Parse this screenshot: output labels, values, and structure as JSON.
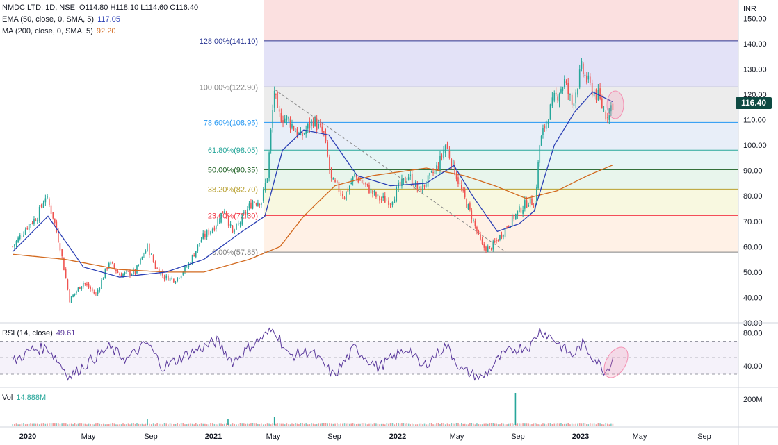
{
  "header": {
    "symbol": "NMDC LTD, 1D, NSE",
    "open_label": "O",
    "open": "114.80",
    "high_label": "H",
    "high": "118.10",
    "low_label": "L",
    "low": "114.60",
    "close_label": "C",
    "close": "116.40"
  },
  "indicators": {
    "ema": {
      "label": "EMA (50, close, 0, SMA, 5)",
      "value": "117.05",
      "color": "#2a3fb4"
    },
    "ma": {
      "label": "MA (200, close, 0, SMA, 5)",
      "value": "92.20",
      "color": "#d2691e"
    },
    "rsi": {
      "label": "RSI (14, close)",
      "value": "49.61",
      "color": "#5b3a9c"
    },
    "vol": {
      "label": "Vol",
      "value": "14.888M",
      "color": "#26a69a"
    }
  },
  "last_price": {
    "value": "116.40",
    "color": "#0e4a42"
  },
  "colors": {
    "up": "#26a69a",
    "down": "#ef5350"
  },
  "chart_data": {
    "type": "candlestick",
    "currency_label": "INR",
    "price_axis": {
      "ticks": [
        "150.00",
        "140.00",
        "130.00",
        "120.00",
        "110.00",
        "100.00",
        "90.00",
        "80.00",
        "70.00",
        "60.00",
        "50.00",
        "40.00",
        "30.00"
      ],
      "range": [
        30,
        155
      ]
    },
    "rsi_axis": {
      "ticks": [
        "80.00",
        "40.00"
      ],
      "bands": [
        30,
        50,
        70
      ]
    },
    "volume_axis": {
      "ticks": [
        "200M"
      ],
      "max": 280
    },
    "time_axis": [
      "2020",
      "May",
      "Sep",
      "2021",
      "May",
      "Sep",
      "2022",
      "May",
      "Sep",
      "2023",
      "May",
      "Sep"
    ],
    "fib_levels": [
      {
        "label": "0.00%(57.85)",
        "value": 57.85,
        "color": "#808080"
      },
      {
        "label": "23.60%(72.30)",
        "value": 72.3,
        "color": "#f23645"
      },
      {
        "label": "38.20%(82.70)",
        "value": 82.7,
        "color": "#b8a030"
      },
      {
        "label": "50.00%(90.35)",
        "value": 90.35,
        "color": "#1b5e20"
      },
      {
        "label": "61.80%(98.05)",
        "value": 98.05,
        "color": "#26a69a"
      },
      {
        "label": "78.60%(108.95)",
        "value": 108.95,
        "color": "#2196f3"
      },
      {
        "label": "100.00%(122.90)",
        "value": 122.9,
        "color": "#808080"
      },
      {
        "label": "128.00%(141.10)",
        "value": 141.1,
        "color": "#283593"
      }
    ],
    "price_path": [
      [
        "2019-12-02",
        60
      ],
      [
        "2019-12-31",
        68
      ],
      [
        "2020-01-20",
        72
      ],
      [
        "2020-02-05",
        80
      ],
      [
        "2020-02-20",
        72
      ],
      [
        "2020-03-05",
        60
      ],
      [
        "2020-03-24",
        39
      ],
      [
        "2020-04-20",
        46
      ],
      [
        "2020-05-15",
        41
      ],
      [
        "2020-06-10",
        54
      ],
      [
        "2020-07-01",
        49
      ],
      [
        "2020-08-01",
        50
      ],
      [
        "2020-08-25",
        60
      ],
      [
        "2020-09-10",
        52
      ],
      [
        "2020-09-28",
        48
      ],
      [
        "2020-10-20",
        47
      ],
      [
        "2020-11-15",
        53
      ],
      [
        "2020-12-10",
        63
      ],
      [
        "2021-01-05",
        68
      ],
      [
        "2021-01-25",
        75
      ],
      [
        "2021-02-10",
        65
      ],
      [
        "2021-03-01",
        71
      ],
      [
        "2021-03-22",
        78
      ],
      [
        "2021-04-08",
        78
      ],
      [
        "2021-04-20",
        88
      ],
      [
        "2021-05-04",
        122
      ],
      [
        "2021-05-10",
        112
      ],
      [
        "2021-06-01",
        110
      ],
      [
        "2021-06-25",
        103
      ],
      [
        "2021-07-20",
        110
      ],
      [
        "2021-08-10",
        104
      ],
      [
        "2021-08-25",
        86
      ],
      [
        "2021-09-20",
        80
      ],
      [
        "2021-10-10",
        88
      ],
      [
        "2021-11-01",
        84
      ],
      [
        "2021-11-25",
        79
      ],
      [
        "2021-12-20",
        78
      ],
      [
        "2022-01-05",
        83
      ],
      [
        "2022-01-25",
        88
      ],
      [
        "2022-02-15",
        82
      ],
      [
        "2022-03-08",
        87
      ],
      [
        "2022-03-25",
        92
      ],
      [
        "2022-04-08",
        100
      ],
      [
        "2022-04-20",
        94
      ],
      [
        "2022-05-10",
        82
      ],
      [
        "2022-05-30",
        72
      ],
      [
        "2022-06-20",
        60
      ],
      [
        "2022-07-05",
        59
      ],
      [
        "2022-07-25",
        64
      ],
      [
        "2022-08-15",
        70
      ],
      [
        "2022-09-05",
        75
      ],
      [
        "2022-09-20",
        78
      ],
      [
        "2022-10-03",
        77
      ],
      [
        "2022-10-12",
        100
      ],
      [
        "2022-10-25",
        110
      ],
      [
        "2022-11-10",
        118
      ],
      [
        "2022-11-30",
        125
      ],
      [
        "2022-12-15",
        116
      ],
      [
        "2023-01-03",
        130
      ],
      [
        "2023-01-20",
        123
      ],
      [
        "2023-02-05",
        119
      ],
      [
        "2023-02-20",
        112
      ],
      [
        "2023-03-06",
        116.4
      ]
    ],
    "ema50_path": [
      [
        "2019-12-02",
        58
      ],
      [
        "2020-02-10",
        72
      ],
      [
        "2020-04-20",
        52
      ],
      [
        "2020-07-01",
        48
      ],
      [
        "2020-10-01",
        50
      ],
      [
        "2020-12-15",
        55
      ],
      [
        "2021-03-01",
        66
      ],
      [
        "2021-04-15",
        72
      ],
      [
        "2021-05-20",
        98
      ],
      [
        "2021-07-01",
        106
      ],
      [
        "2021-08-20",
        104
      ],
      [
        "2021-10-15",
        88
      ],
      [
        "2021-12-20",
        84
      ],
      [
        "2022-03-01",
        85
      ],
      [
        "2022-04-25",
        92
      ],
      [
        "2022-06-01",
        80
      ],
      [
        "2022-07-20",
        66
      ],
      [
        "2022-09-01",
        69
      ],
      [
        "2022-10-01",
        74
      ],
      [
        "2022-11-10",
        100
      ],
      [
        "2022-12-20",
        113
      ],
      [
        "2023-01-25",
        121
      ],
      [
        "2023-03-06",
        117.05
      ]
    ],
    "ma200_path": [
      [
        "2019-12-02",
        57
      ],
      [
        "2020-03-15",
        55
      ],
      [
        "2020-07-01",
        51
      ],
      [
        "2020-10-01",
        50
      ],
      [
        "2020-12-15",
        50
      ],
      [
        "2021-03-15",
        55
      ],
      [
        "2021-05-15",
        60
      ],
      [
        "2021-07-01",
        72
      ],
      [
        "2021-09-01",
        84
      ],
      [
        "2021-11-15",
        88
      ],
      [
        "2022-03-01",
        91
      ],
      [
        "2022-05-15",
        88
      ],
      [
        "2022-07-15",
        84
      ],
      [
        "2022-09-15",
        79
      ],
      [
        "2022-11-15",
        82
      ],
      [
        "2023-01-15",
        88
      ],
      [
        "2023-03-06",
        92.2
      ]
    ],
    "rsi_path": [
      [
        "2019-12-02",
        45
      ],
      [
        "2020-01-10",
        60
      ],
      [
        "2020-02-10",
        62
      ],
      [
        "2020-03-24",
        27
      ],
      [
        "2020-05-01",
        45
      ],
      [
        "2020-06-10",
        62
      ],
      [
        "2020-07-15",
        48
      ],
      [
        "2020-08-25",
        68
      ],
      [
        "2020-09-25",
        38
      ],
      [
        "2020-11-15",
        55
      ],
      [
        "2021-01-10",
        70
      ],
      [
        "2021-02-10",
        45
      ],
      [
        "2021-03-20",
        65
      ],
      [
        "2021-05-04",
        85
      ],
      [
        "2021-06-01",
        52
      ],
      [
        "2021-07-15",
        58
      ],
      [
        "2021-08-30",
        28
      ],
      [
        "2021-10-10",
        62
      ],
      [
        "2021-11-25",
        38
      ],
      [
        "2022-01-25",
        62
      ],
      [
        "2022-02-20",
        38
      ],
      [
        "2022-04-10",
        65
      ],
      [
        "2022-05-10",
        35
      ],
      [
        "2022-06-20",
        25
      ],
      [
        "2022-07-25",
        50
      ],
      [
        "2022-08-20",
        60
      ],
      [
        "2022-09-25",
        65
      ],
      [
        "2022-10-12",
        84
      ],
      [
        "2022-11-10",
        72
      ],
      [
        "2022-12-15",
        52
      ],
      [
        "2023-01-05",
        66
      ],
      [
        "2023-02-20",
        33
      ],
      [
        "2023-03-06",
        49.61
      ]
    ],
    "volume_spikes": [
      [
        "2021-05-04",
        60
      ],
      [
        "2022-08-25",
        230
      ],
      [
        "2021-02-01",
        40
      ],
      [
        "2020-08-25",
        45
      ]
    ],
    "trend_line": [
      [
        "2021-05-04",
        122
      ],
      [
        "2022-08-05",
        58
      ]
    ]
  }
}
